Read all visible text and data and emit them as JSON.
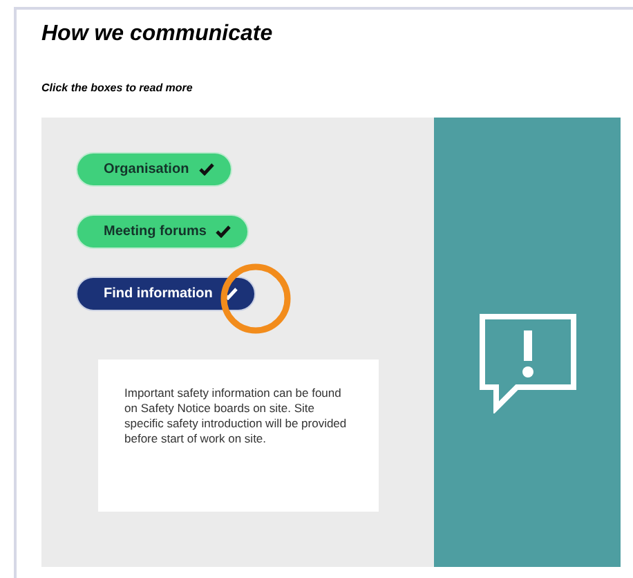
{
  "title": "How we communicate",
  "instruction": "Click the boxes to read more",
  "items": [
    {
      "label": "Organisation",
      "selected": false,
      "checked": true,
      "circled": false
    },
    {
      "label": "Meeting forums",
      "selected": false,
      "checked": true,
      "circled": false
    },
    {
      "label": "Find information",
      "selected": true,
      "checked": true,
      "circled": true
    }
  ],
  "info_text": "Important safety information can be found on Safety Notice boards on site. Site specific safety introduction will be provided before start of work on site."
}
